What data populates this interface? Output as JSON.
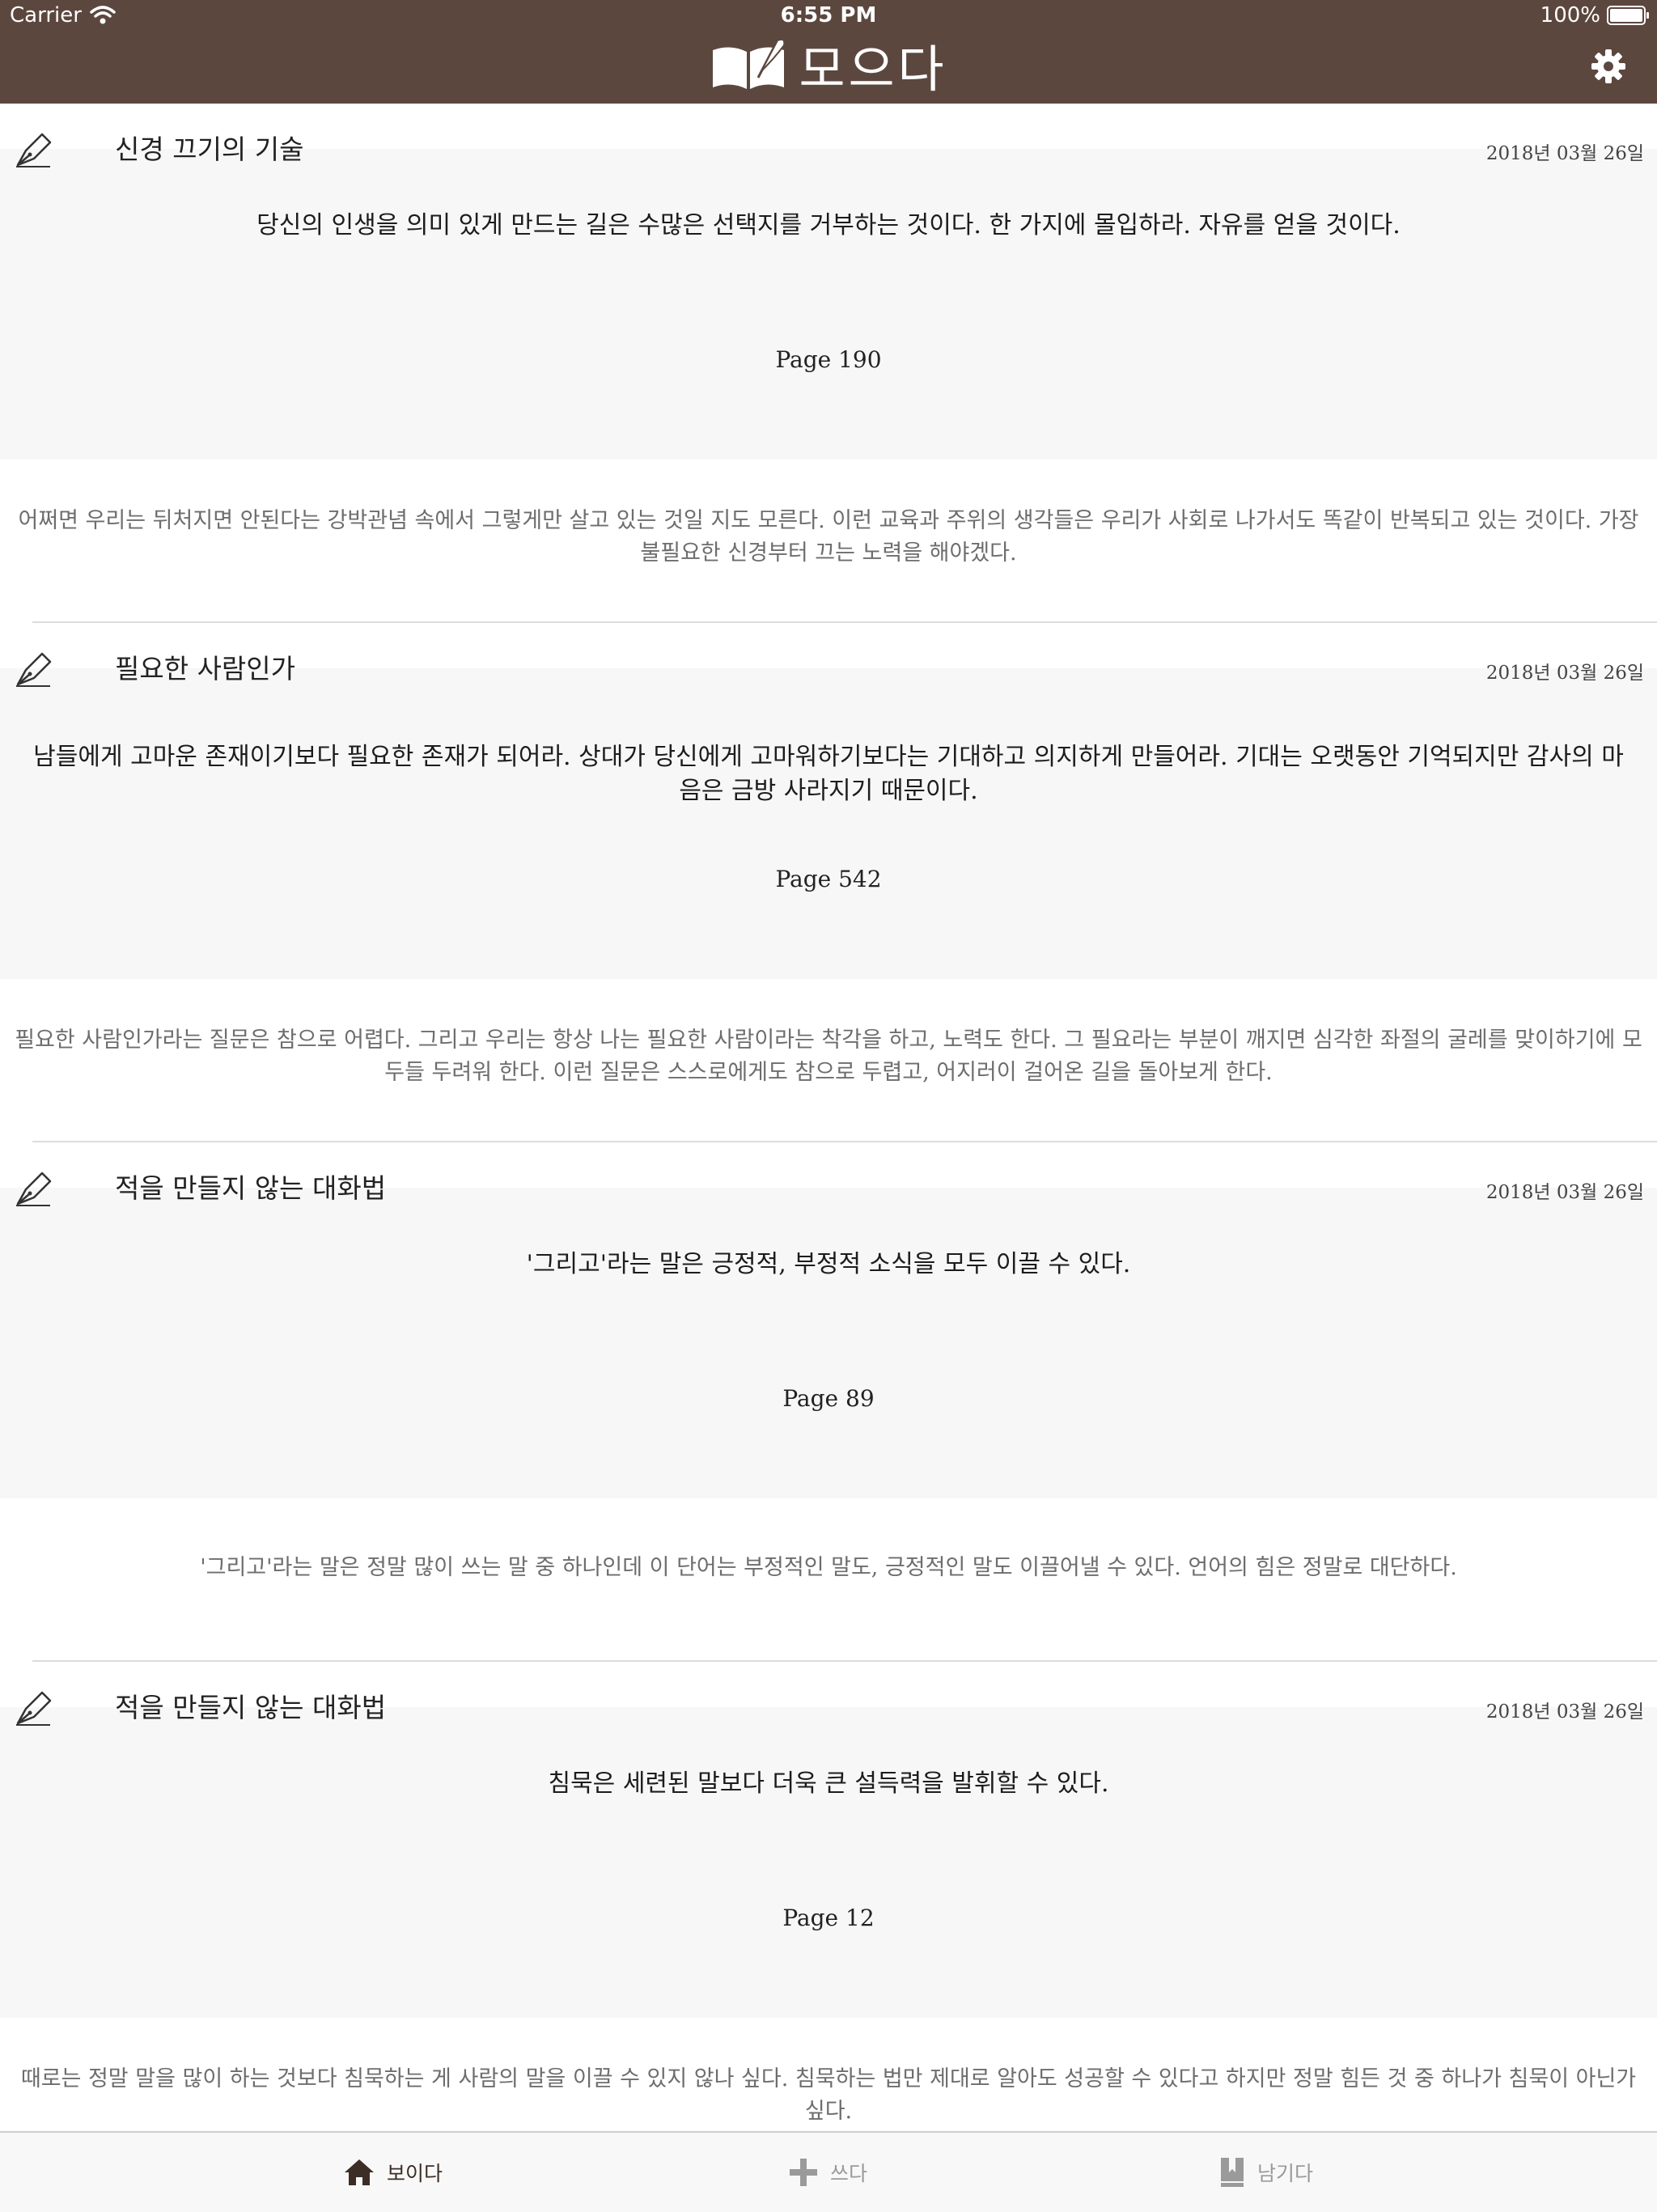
{
  "status_bar": {
    "carrier": "Carrier",
    "time": "6:55 PM",
    "battery": "100%"
  },
  "nav": {
    "title": "모으다"
  },
  "entries": [
    {
      "title": "신경 끄기의 기술",
      "date": "2018년 03월 26일",
      "quote": "당신의 인생을 의미 있게 만드는 길은 수많은 선택지를 거부하는 것이다. 한 가지에 몰입하라. 자유를 얻을 것이다.",
      "page": "Page 190",
      "comment": "어쩌면 우리는 뒤처지면 안된다는 강박관념 속에서 그렇게만 살고 있는 것일 지도 모른다. 이런 교육과 주위의 생각들은 우리가 사회로 나가서도 똑같이 반복되고 있는 것이다. 가장 불필요한 신경부터 끄는 노력을 해야겠다."
    },
    {
      "title": "필요한 사람인가",
      "date": "2018년 03월 26일",
      "quote": "남들에게 고마운 존재이기보다 필요한 존재가 되어라. 상대가 당신에게 고마워하기보다는 기대하고 의지하게 만들어라. 기대는 오랫동안 기억되지만 감사의 마음은 금방 사라지기 때문이다.",
      "page": "Page 542",
      "comment": "필요한 사람인가라는 질문은 참으로 어렵다. 그리고 우리는 항상 나는 필요한 사람이라는 착각을 하고, 노력도 한다. 그 필요라는 부분이 깨지면 심각한 좌절의 굴레를 맞이하기에 모두들 두려워 한다. 이런 질문은 스스로에게도 참으로 두렵고, 어지러이 걸어온 길을 돌아보게 한다."
    },
    {
      "title": "적을 만들지 않는 대화법",
      "date": "2018년 03월 26일",
      "quote": "'그리고'라는 말은 긍정적, 부정적 소식을 모두 이끌 수 있다.",
      "page": "Page 89",
      "comment": "'그리고'라는 말은 정말 많이 쓰는 말 중 하나인데 이 단어는 부정적인 말도, 긍정적인 말도 이끌어낼 수 있다. 언어의 힘은 정말로 대단하다."
    },
    {
      "title": "적을 만들지 않는 대화법",
      "date": "2018년 03월 26일",
      "quote": "침묵은 세련된 말보다 더욱 큰 설득력을 발휘할 수 있다.",
      "page": "Page 12",
      "comment": "때로는 정말 말을 많이 하는 것보다 침묵하는 게 사람의 말을 이끌 수 있지 않나 싶다. 침묵하는 법만 제대로 알아도 성공할 수 있다고 하지만 정말 힘든 것 중 하나가 침묵이 아닌가 싶다."
    }
  ],
  "tabs": {
    "home": "보이다",
    "write": "쓰다",
    "save": "남기다"
  },
  "colors": {
    "nav_background": "#5c473f",
    "active_tab": "#3c2d27",
    "inactive_tab": "#9a9a9a",
    "quote_background": "#f7f7f7"
  },
  "icons": {
    "entry": "fountain-pen-icon",
    "logo": "book-quill-icon",
    "settings": "gear-icon",
    "home_tab": "house-icon",
    "write_tab": "plus-icon",
    "save_tab": "bookmark-book-icon"
  }
}
